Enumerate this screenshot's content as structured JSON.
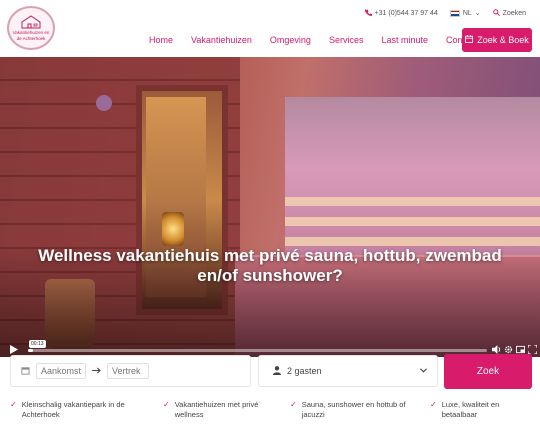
{
  "logo": {
    "text_line1": "Vakantiehuizen en",
    "text_line2": "de Achterhoek"
  },
  "topbar": {
    "phone_icon": "phone-icon",
    "phone": "+31 (0)544 37 97 44",
    "language": "NL",
    "language_chevron": "⌄",
    "search_icon": "search-icon",
    "search_label": "Zoeken"
  },
  "nav": {
    "items": [
      "Home",
      "Vakantiehuizen",
      "Omgeving",
      "Services",
      "Last minute",
      "Contact"
    ],
    "book_button": "Zoek & Boek",
    "book_icon": "calendar-icon"
  },
  "hero": {
    "title": "Wellness vakantiehuis met privé sauna, hottub, zwembad en/of sunshower?"
  },
  "video": {
    "time": "00:13",
    "progress": 0.01,
    "icons": [
      "play-icon",
      "volume-icon",
      "settings-icon",
      "fullscreen-icon"
    ]
  },
  "search": {
    "arrival_placeholder": "Aankomst",
    "departure_placeholder": "Vertrek",
    "guests_value": "2 gasten",
    "submit_label": "Zoek"
  },
  "usps": [
    "Kleinschalig vakantiepark in de Achterhoek",
    "Vakantiehuizen met privé wellness",
    "Sauna, sunshower en hottub of jacuzzi",
    "Luxe, kwaliteit en betaalbaar"
  ],
  "colors": {
    "brand": "#d81b6a",
    "text": "#333333"
  }
}
